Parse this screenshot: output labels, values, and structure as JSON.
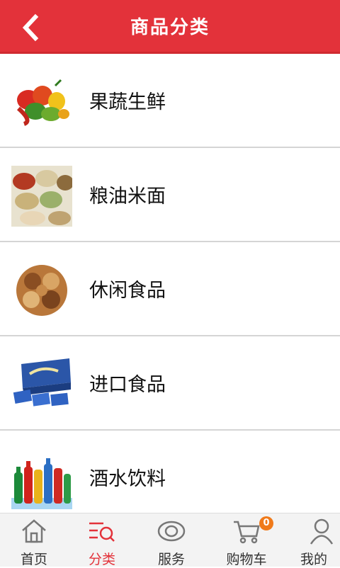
{
  "header": {
    "title": "商品分类",
    "back_icon": "chevron-left-icon"
  },
  "categories": [
    {
      "label": "果蔬生鲜",
      "icon": "vegetables-image"
    },
    {
      "label": "粮油米面",
      "icon": "grain-sacks-image"
    },
    {
      "label": "休闲食品",
      "icon": "nuts-image"
    },
    {
      "label": "进口食品",
      "icon": "snack-box-image"
    },
    {
      "label": "酒水饮料",
      "icon": "drinks-bottles-image"
    }
  ],
  "tabbar": {
    "items": [
      {
        "label": "首页",
        "icon": "home-icon",
        "active": false
      },
      {
        "label": "分类",
        "icon": "category-search-icon",
        "active": true
      },
      {
        "label": "服务",
        "icon": "eye-service-icon",
        "active": false
      },
      {
        "label": "购物车",
        "icon": "cart-icon",
        "active": false,
        "badge": "0"
      },
      {
        "label": "我的",
        "icon": "user-icon",
        "active": false
      }
    ]
  },
  "colors": {
    "accent": "#e3323a",
    "badge": "#f07a1a"
  }
}
